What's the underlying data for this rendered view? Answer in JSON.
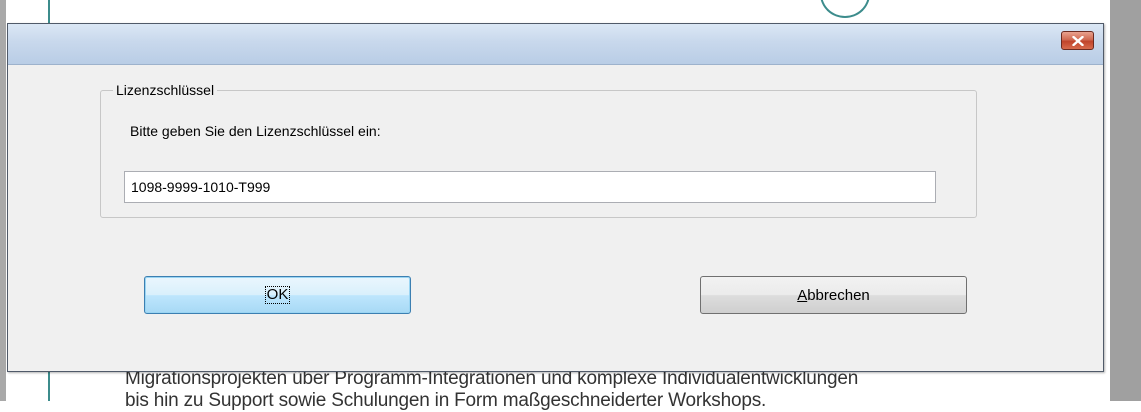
{
  "background": {
    "line1": "Migrationsprojekten über Programm-Integrationen und komplexe Individualentwicklungen",
    "line2": "bis hin zu Support sowie Schulungen in Form maßgeschneiderter Workshops."
  },
  "dialog": {
    "title": "",
    "close_icon": "close-x-icon",
    "group_label": "Lizenzschlüssel",
    "prompt": "Bitte geben Sie den Lizenzschlüssel ein:",
    "license_key_value": "1098-9999-1010-T999",
    "ok_label": "OK",
    "cancel_label_accel": "A",
    "cancel_label_rest": "bbrechen"
  },
  "colors": {
    "titlebar": "#c8d8ec",
    "close_button": "#c0442b",
    "ok_button_border": "#3c7fb1",
    "background_accent": "#3c8c8c"
  }
}
